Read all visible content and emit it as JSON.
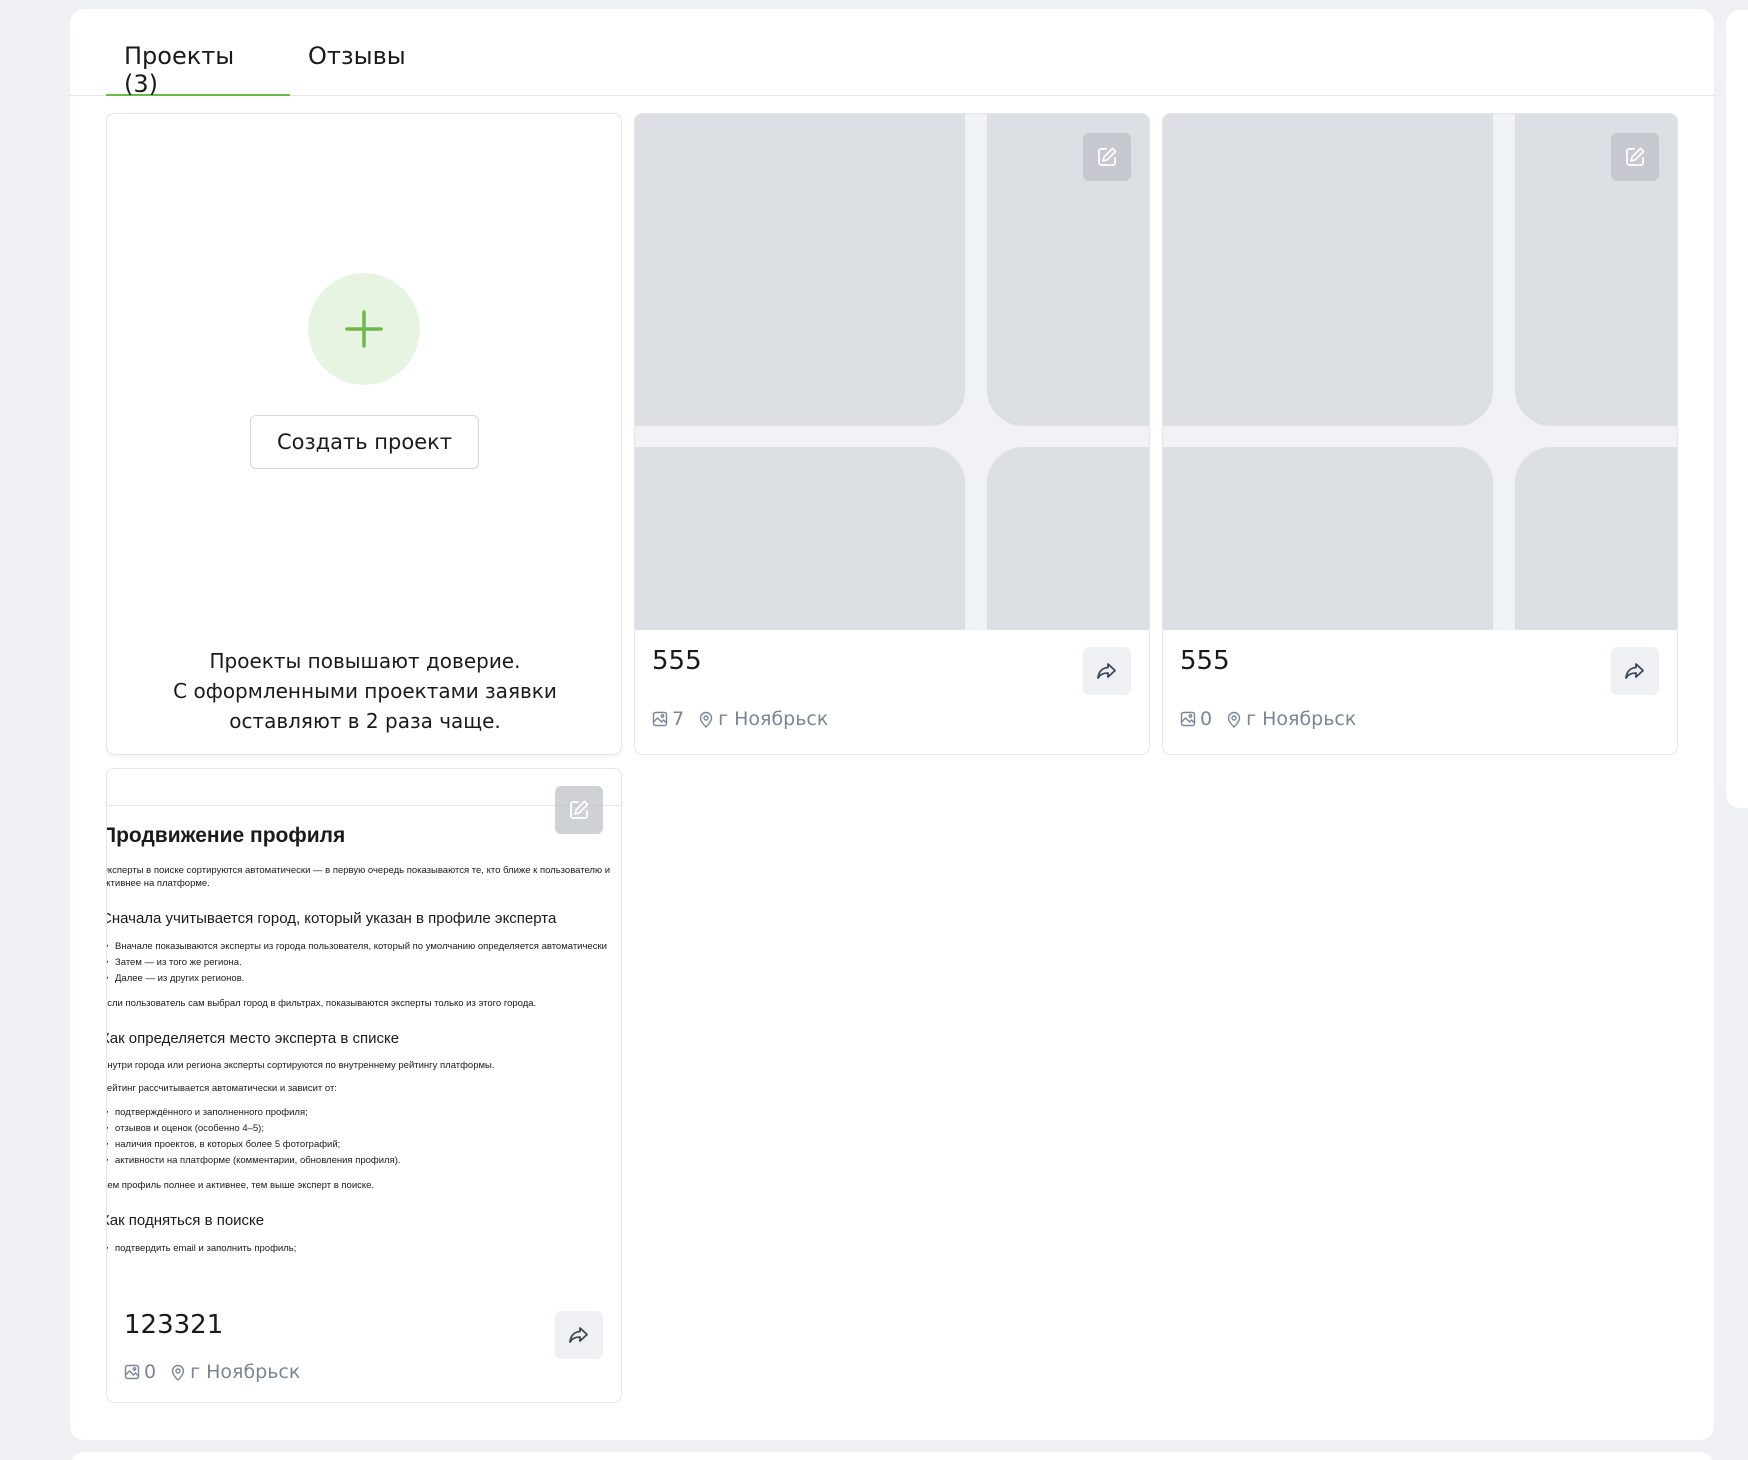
{
  "tabs": [
    {
      "label": "Проекты (3)",
      "active": true
    },
    {
      "label": "Отзывы",
      "active": false
    }
  ],
  "create_card": {
    "button_label": "Создать проект",
    "promo_lines": [
      "Проекты повышают доверие.",
      "С оформленными проектами заявки",
      "оставляют в 2 раза чаще."
    ]
  },
  "projects": [
    {
      "title": "555",
      "photos": "7",
      "city": "г Ноябрьск"
    },
    {
      "title": "555",
      "photos": "0",
      "city": "г Ноябрьск"
    },
    {
      "title": "123321",
      "photos": "0",
      "city": "г Ноябрьск"
    }
  ],
  "doc_preview": {
    "h1": "Продвижение профиля",
    "p1": "Эксперты в поиске сортируются автоматически — в первую очередь показываются те, кто ближе к пользователю и",
    "p1b": "активнее на платформе.",
    "h2a": "Сначала учитывается город, который указан в профиле эксперта",
    "list1": [
      "Вначале показываются эксперты из города пользователя, который по умолчанию определяется автоматически",
      "Затем — из того же региона.",
      "Далее — из других регионов."
    ],
    "p2": "Если пользователь сам выбрал город в фильтрах, показываются эксперты только из этого города.",
    "h2b": "Как определяется место эксперта в списке",
    "p3": "Внутри города или региона эксперты сортируются по внутреннему рейтингу платформы.",
    "p4": "Рейтинг рассчитывается автоматически и зависит от:",
    "list2": [
      "подтверждённого и заполненного профиля;",
      "отзывов и оценок (особенно 4–5);",
      "наличия проектов, в которых более 5 фотографий;",
      "активности на платформе (комментарии, обновления профиля)."
    ],
    "p5": "Чем профиль полнее и активнее, тем выше эксперт в поиске.",
    "h2c": "Как подняться в поиске",
    "list3": [
      "подтвердить email и заполнить профиль;"
    ]
  },
  "colors": {
    "accent": "#6cba4a",
    "background": "#eef0f4",
    "meta_text": "#7a8596"
  },
  "icons": [
    "plus-icon",
    "edit-icon",
    "share-icon",
    "image-icon",
    "location-pin-icon"
  ]
}
